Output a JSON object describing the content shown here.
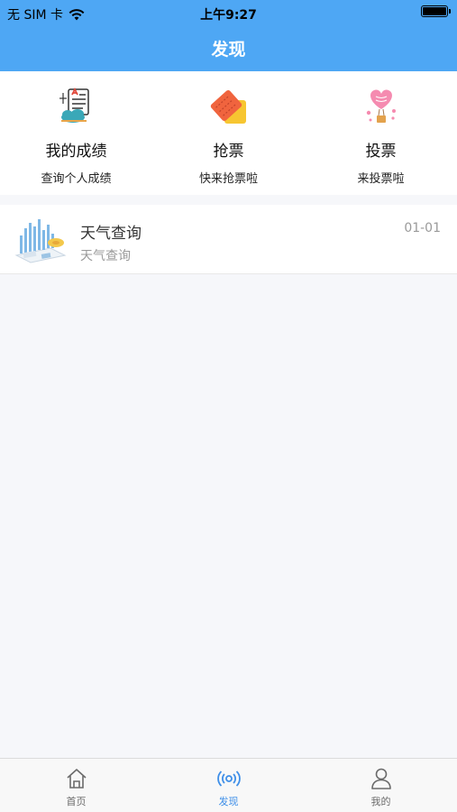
{
  "status_bar": {
    "carrier": "无 SIM 卡",
    "time": "上午9:27"
  },
  "header": {
    "title": "发现"
  },
  "features": [
    {
      "title": "我的成绩",
      "subtitle": "查询个人成绩",
      "icon": "report-icon"
    },
    {
      "title": "抢票",
      "subtitle": "快来抢票啦",
      "icon": "ticket-icon"
    },
    {
      "title": "投票",
      "subtitle": "来投票啦",
      "icon": "heart-balloon-icon"
    }
  ],
  "list": [
    {
      "title": "天气查询",
      "subtitle": "天气查询",
      "date": "01-01",
      "icon": "weather-chart-icon"
    }
  ],
  "tabbar": {
    "items": [
      {
        "label": "首页",
        "icon": "home-icon",
        "active": false
      },
      {
        "label": "发现",
        "icon": "discover-icon",
        "active": true
      },
      {
        "label": "我的",
        "icon": "user-icon",
        "active": false
      }
    ]
  },
  "colors": {
    "header_bg": "#4ea7f4",
    "tab_active": "#3f8fe8",
    "tab_inactive": "#6b6b6b"
  }
}
